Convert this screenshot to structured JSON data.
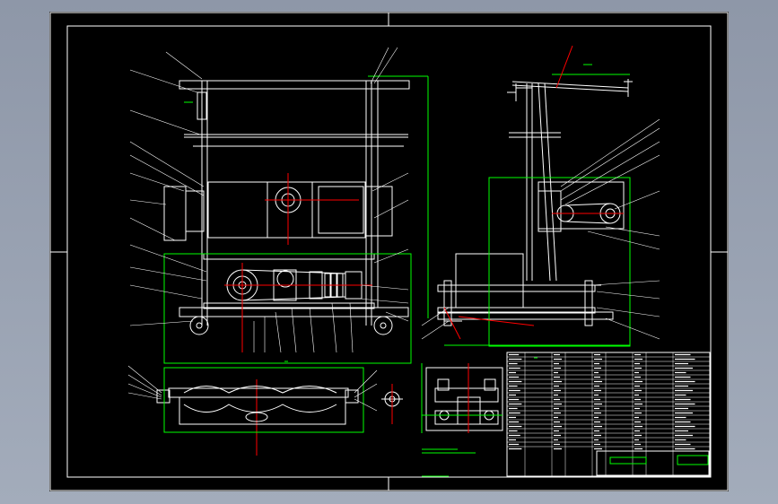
{
  "viewer": {
    "background_color": "#9aa3b4",
    "sheet_color": "#000000"
  },
  "drawing": {
    "line_color": "#ffffff",
    "center_line_color": "#ff0000",
    "dimension_color": "#00ff00",
    "accent_color": "#00ffff",
    "views": [
      "front-view",
      "side-view",
      "bottom-view",
      "section-detail",
      "small-detail"
    ],
    "title_block": {
      "rows": 22,
      "columns": 8
    }
  }
}
